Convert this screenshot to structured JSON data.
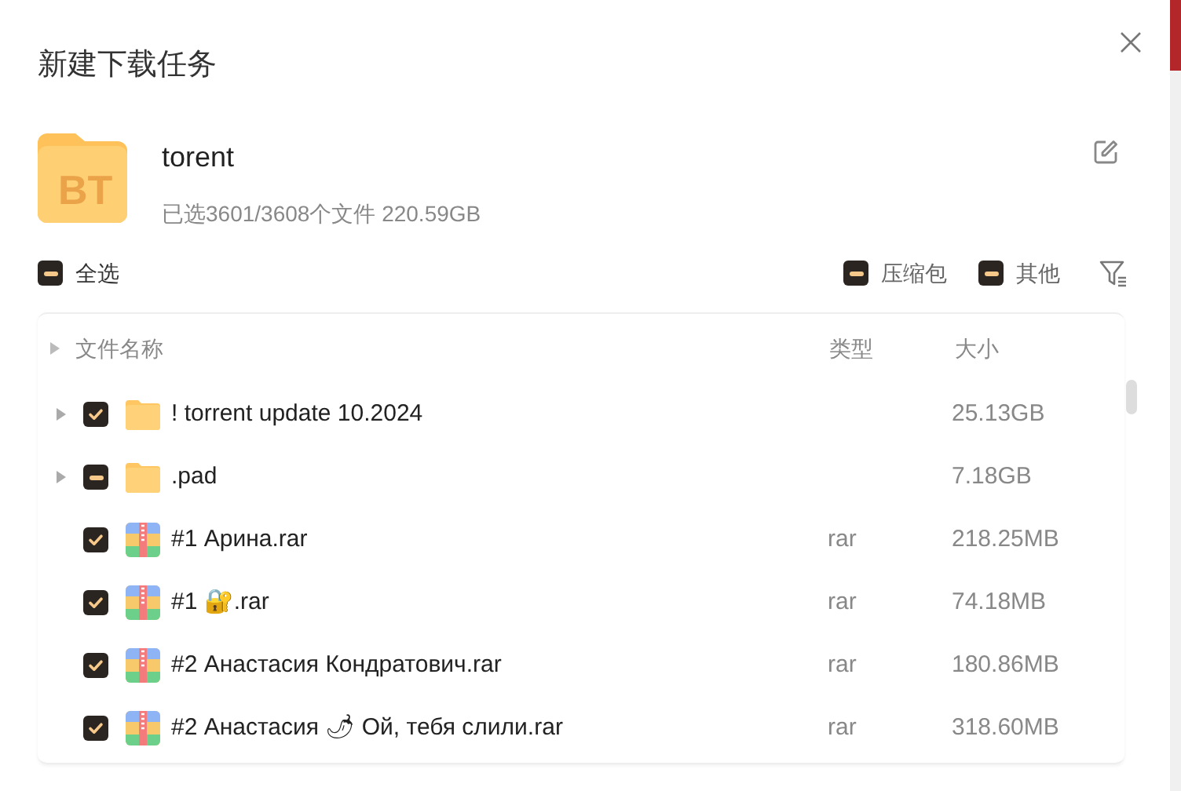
{
  "dialog": {
    "title": "新建下载任务"
  },
  "torrent": {
    "name": "torent",
    "summary": "已选3601/3608个文件 220.59GB",
    "badge": "BT"
  },
  "filters": [
    {
      "label": "全选",
      "checked": true,
      "indeterminate": true
    },
    {
      "label": "压缩包",
      "checked": true,
      "indeterminate": true
    },
    {
      "label": "其他",
      "checked": true,
      "indeterminate": true
    }
  ],
  "table": {
    "columns": [
      "文件名称",
      "类型",
      "大小"
    ],
    "rows": [
      {
        "kind": "folder",
        "name": "! torrent update 10.2024",
        "type": "",
        "size": "25.13GB",
        "checked": true,
        "indeterminate": false
      },
      {
        "kind": "folder",
        "name": ".pad",
        "type": "",
        "size": "7.18GB",
        "checked": true,
        "indeterminate": true
      },
      {
        "kind": "archive",
        "name": "#1 Арина.rar",
        "type": "rar",
        "size": "218.25MB",
        "checked": true,
        "indeterminate": false
      },
      {
        "kind": "archive",
        "name": "#1 🔐.rar",
        "type": "rar",
        "size": "74.18MB",
        "checked": true,
        "indeterminate": false
      },
      {
        "kind": "archive",
        "name": "#2 Анастасия Кондратович.rar",
        "type": "rar",
        "size": "180.86MB",
        "checked": true,
        "indeterminate": false
      },
      {
        "kind": "archive",
        "name": "#2 Анастасия 🌶 Ой, тебя слили.rar",
        "type": "rar",
        "size": "318.60MB",
        "checked": true,
        "indeterminate": false
      }
    ]
  }
}
